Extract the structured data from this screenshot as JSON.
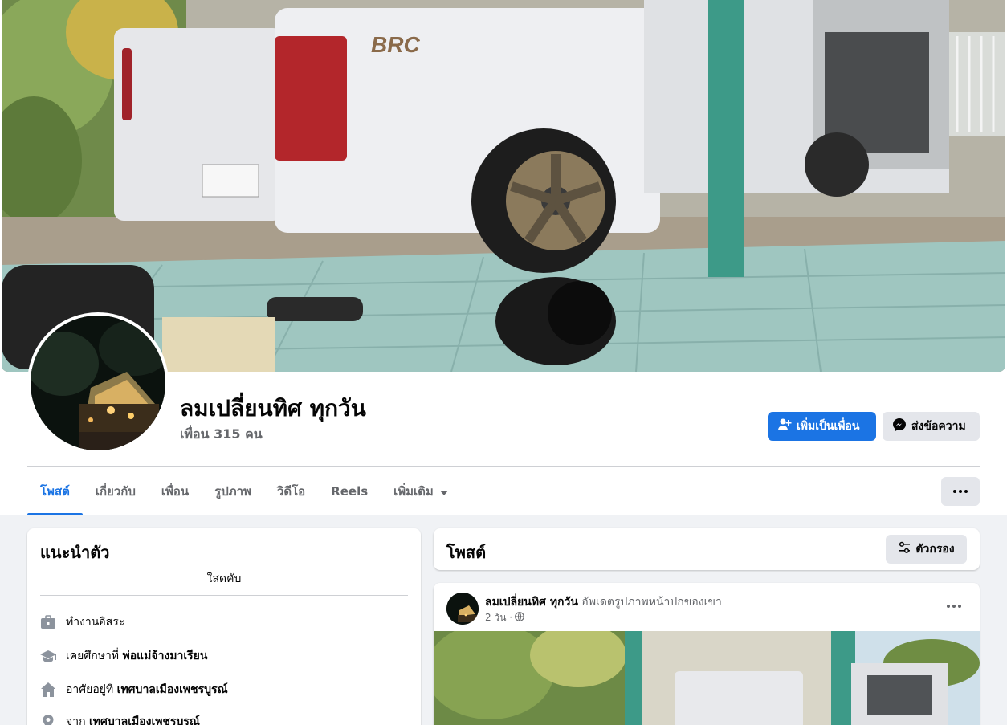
{
  "profile": {
    "name": "ลมเปลี่ยนทิศ ทุกวัน",
    "friends_text": "เพื่อน 315 คน"
  },
  "actions": {
    "add_friend": "เพิ่มเป็นเพื่อน",
    "message": "ส่งข้อความ"
  },
  "tabs": [
    {
      "label": "โพสต์"
    },
    {
      "label": "เกี่ยวกับ"
    },
    {
      "label": "เพื่อน"
    },
    {
      "label": "รูปภาพ"
    },
    {
      "label": "วิดีโอ"
    },
    {
      "label": "Reels"
    },
    {
      "label": "เพิ่มเติม"
    }
  ],
  "intro": {
    "title": "แนะนำตัว",
    "bio": "ใสดคับ",
    "items": [
      {
        "icon": "briefcase-icon",
        "prefix": "ทำงานอิสระ",
        "value": ""
      },
      {
        "icon": "graduation-cap-icon",
        "prefix": "เคยศึกษาที่ ",
        "value": "พ่อแม่จ้างมาเรียน"
      },
      {
        "icon": "home-icon",
        "prefix": "อาศัยอยู่ที่ ",
        "value": "เทศบาลเมืองเพชรบูรณ์"
      },
      {
        "icon": "location-pin-icon",
        "prefix": "จาก ",
        "value": "เทศบาลเมืองเพชรบูรณ์"
      }
    ]
  },
  "posts": {
    "title": "โพสต์",
    "filter_label": "ตัวกรอง",
    "item": {
      "author": "ลมเปลี่ยนทิศ ทุกวัน",
      "action": "อัพเดตรูปภาพหน้าปกของเขา",
      "time": "2 วัน ·"
    }
  },
  "colors": {
    "accent": "#1b74e4",
    "secondary_button": "#e4e6eb",
    "muted_text": "#65676b",
    "page_background": "#f0f2f5"
  }
}
